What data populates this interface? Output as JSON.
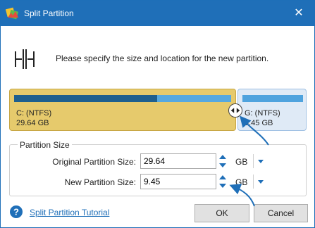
{
  "window": {
    "title": "Split Partition",
    "close_glyph": "✕"
  },
  "instruction": "Please specify the size and location for the new partition.",
  "partitions": [
    {
      "name": "C: (NTFS)",
      "size": "29.64 GB",
      "used_fraction": 0.66,
      "color": "#e6ca6c"
    },
    {
      "name": "G: (NTFS)",
      "size": "9.45 GB",
      "color": "#dfeaf6"
    }
  ],
  "partition_size": {
    "group_title": "Partition Size",
    "original_label": "Original Partition Size:",
    "original_value": "29.64",
    "original_unit": "GB",
    "new_label": "New Partition Size:",
    "new_value": "9.45",
    "new_unit": "GB"
  },
  "footer": {
    "tutorial_link": "Split Partition Tutorial",
    "ok_label": "OK",
    "cancel_label": "Cancel"
  },
  "icons": {
    "app": "app-logo-icon",
    "close": "close-icon",
    "split": "split-partition-icon",
    "handle": "drag-handle-icon",
    "help": "help-icon",
    "spin_up": "spin-up-icon",
    "spin_down": "spin-down-icon",
    "dropdown": "dropdown-arrow-icon"
  },
  "colors": {
    "titlebar": "#1f6fb8",
    "accent": "#1f6fb8",
    "used_bar": "#1e5f8e",
    "free_bar": "#55a8e0"
  }
}
